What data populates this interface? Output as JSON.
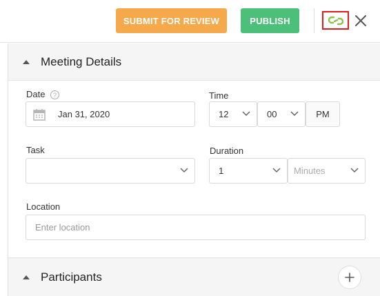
{
  "toolbar": {
    "submit_label": "SUBMIT FOR REVIEW",
    "publish_label": "PUBLISH",
    "link_icon": "link-sync-icon",
    "close_icon": "close-icon",
    "colors": {
      "submit": "#f6a94a",
      "publish": "#4cbf78",
      "link_icon": "#8bc34a",
      "highlight": "#e21c1c"
    }
  },
  "meeting_details": {
    "title": "Meeting Details",
    "date": {
      "label": "Date",
      "value": "Jan 31, 2020",
      "icon": "calendar-icon",
      "help_icon": "help-icon"
    },
    "time": {
      "label": "Time",
      "hour": "12",
      "minute": "00",
      "meridiem": "PM"
    },
    "task": {
      "label": "Task",
      "value": ""
    },
    "duration": {
      "label": "Duration",
      "value": "1",
      "unit_placeholder": "Minutes"
    },
    "location": {
      "label": "Location",
      "placeholder": "Enter location"
    }
  },
  "participants": {
    "title": "Participants",
    "add_icon": "plus-icon"
  }
}
